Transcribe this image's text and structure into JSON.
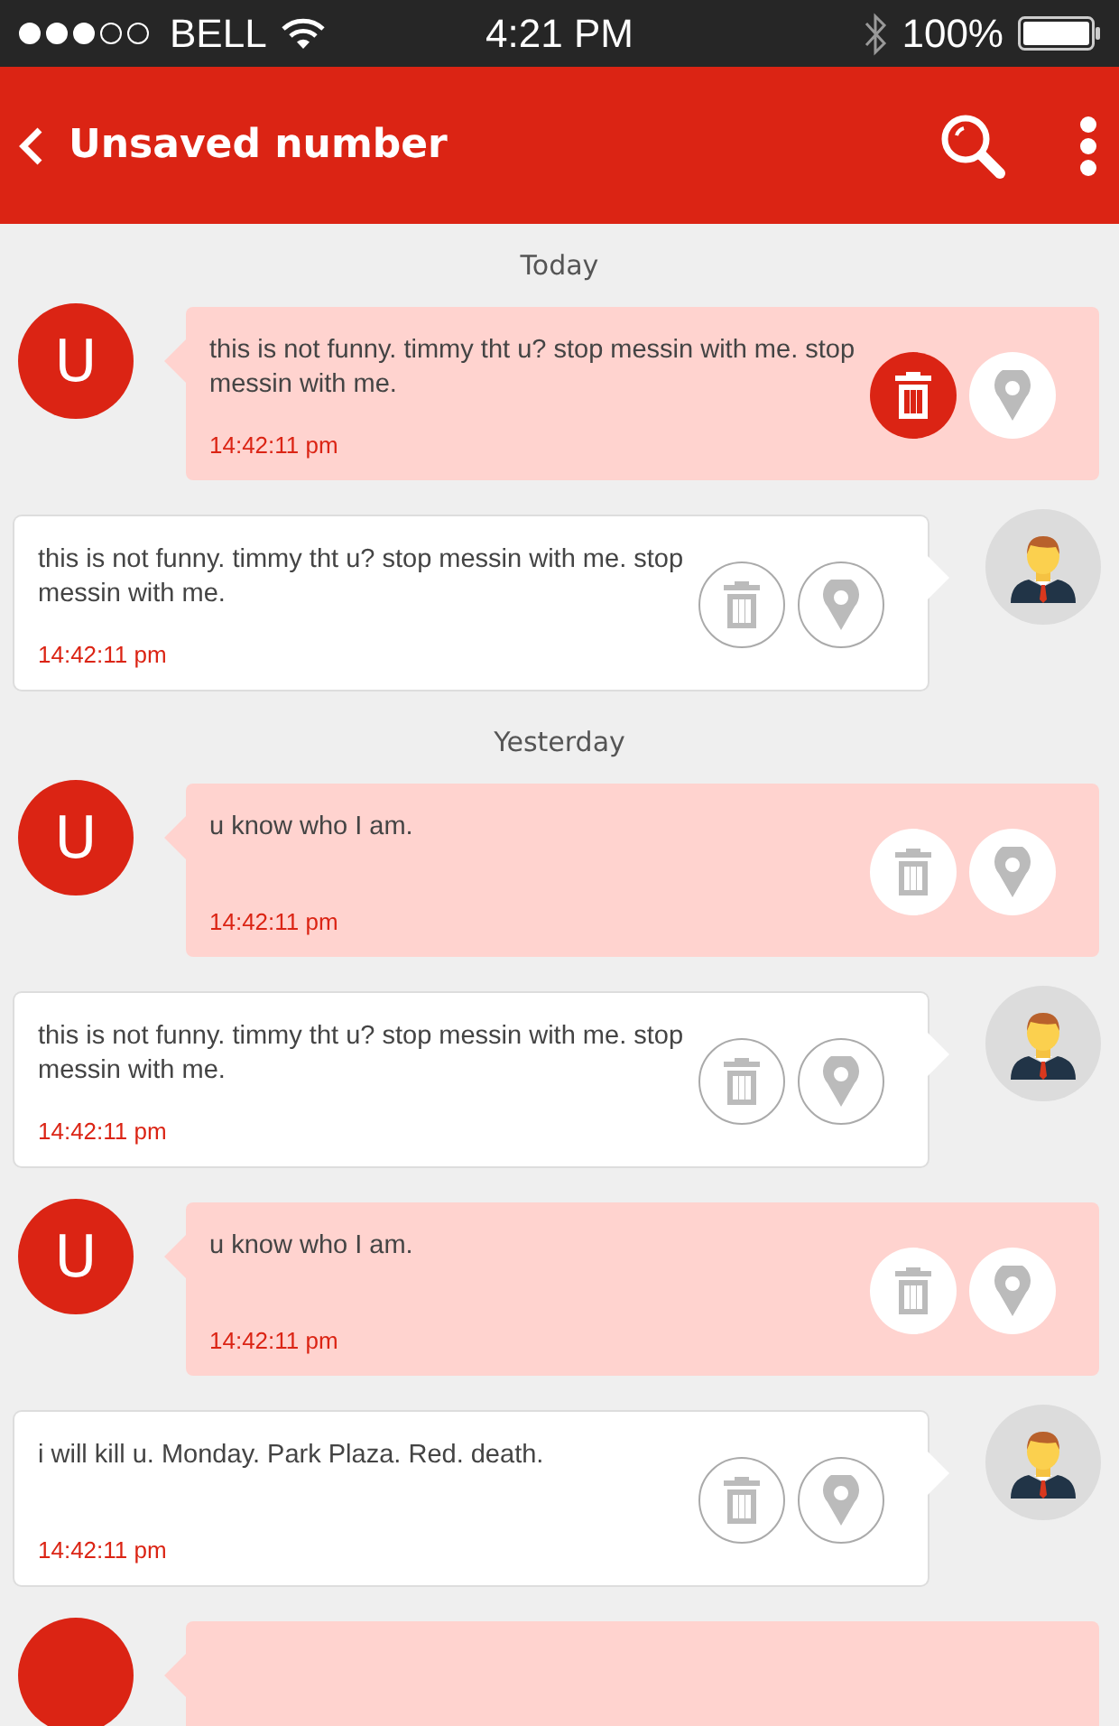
{
  "status_bar": {
    "signal": [
      {
        "filled": true
      },
      {
        "filled": true
      },
      {
        "filled": true
      },
      {
        "filled": false
      },
      {
        "filled": false
      }
    ],
    "carrier": "BELL",
    "time": "4:21 PM",
    "battery": "100%"
  },
  "app_bar": {
    "title": "Unsaved number"
  },
  "messages": [
    {
      "kind": "date",
      "label": "Today"
    },
    {
      "kind": "incoming",
      "avatar": "U",
      "text": "this is not funny. timmy tht u? stop messin with me. stop messin with me.",
      "time": "14:42:11 pm",
      "delete_selected": true
    },
    {
      "kind": "outgoing",
      "text": "this is not funny. timmy tht u? stop messin with me. stop messin with me.",
      "time": "14:42:11 pm",
      "delete_selected": false
    },
    {
      "kind": "date",
      "label": "Yesterday"
    },
    {
      "kind": "incoming",
      "avatar": "U",
      "text": "u know who I am.",
      "time": "14:42:11 pm",
      "delete_selected": false
    },
    {
      "kind": "outgoing",
      "text": "this is not funny. timmy tht u? stop messin with me. stop messin with me.",
      "time": "14:42:11 pm",
      "delete_selected": false
    },
    {
      "kind": "incoming",
      "avatar": "U",
      "text": "u know who I am.",
      "time": "14:42:11 pm",
      "delete_selected": false
    },
    {
      "kind": "outgoing",
      "text": "i will kill u. Monday. Park Plaza. Red. death.",
      "time": "14:42:11 pm",
      "delete_selected": false
    },
    {
      "kind": "incoming"
    }
  ]
}
